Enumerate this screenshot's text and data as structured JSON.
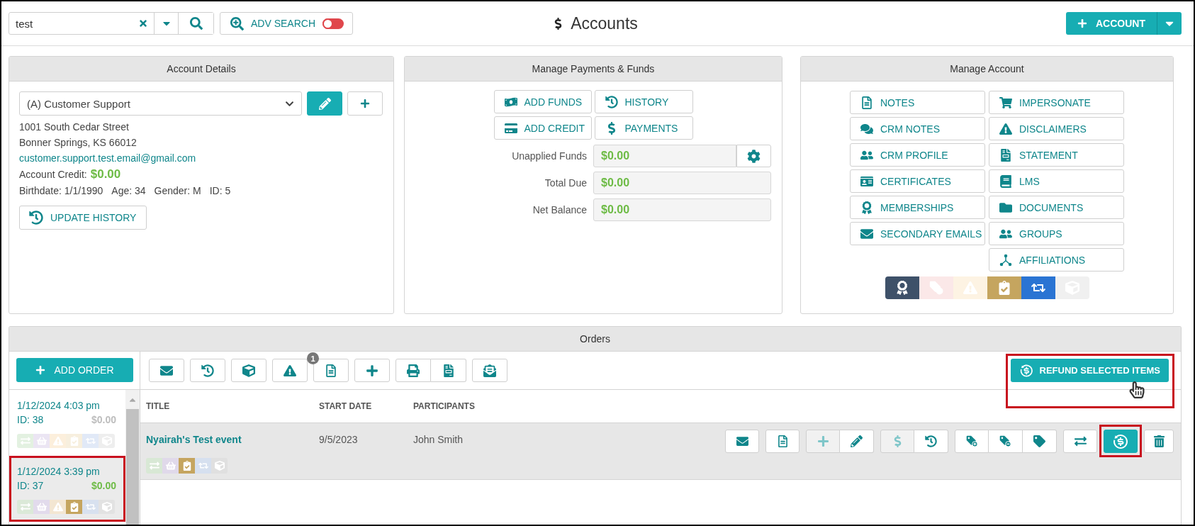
{
  "top_bar": {
    "search": {
      "value": "test"
    },
    "adv_search": {
      "label": "ADV SEARCH",
      "on": false
    },
    "title": "Accounts",
    "new_account": {
      "label": "ACCOUNT"
    }
  },
  "account_details": {
    "title": "Account Details",
    "account": {
      "value": "(A) Customer Support"
    },
    "address": [
      "1001 South Cedar Street",
      "Bonner Springs, KS 66012"
    ],
    "email": "customer.support.test.email@gmail.com",
    "credit": {
      "label": "Account Credit:",
      "value": "$0.00"
    },
    "facts": [
      "Birthdate: 1/1/1990",
      "Age: 34",
      "Gender: M",
      "ID: 5"
    ],
    "update_history": {
      "label": "UPDATE HISTORY"
    }
  },
  "payments": {
    "title": "Manage Payments & Funds",
    "buttons": [
      {
        "kind": "add_funds",
        "label": "ADD FUNDS"
      },
      {
        "kind": "history",
        "label": "HISTORY"
      },
      {
        "kind": "add_credit",
        "label": "ADD CREDIT"
      },
      {
        "kind": "payments",
        "label": "PAYMENTS"
      }
    ],
    "fields": [
      {
        "label": "Unapplied Funds",
        "value": "$0.00",
        "settings": true
      },
      {
        "label": "Total Due",
        "value": "$0.00",
        "settings": false
      },
      {
        "label": "Net Balance",
        "value": "$0.00",
        "settings": false
      }
    ]
  },
  "manage_account": {
    "title": "Manage Account",
    "columns": [
      [
        {
          "kind": "notes",
          "label": "NOTES"
        },
        {
          "kind": "crm_notes",
          "label": "CRM NOTES"
        },
        {
          "kind": "crm_profile",
          "label": "CRM PROFILE"
        },
        {
          "kind": "certificates",
          "label": "CERTIFICATES"
        },
        {
          "kind": "memberships",
          "label": "MEMBERSHIPS"
        },
        {
          "kind": "secondary_emails",
          "label": "SECONDARY EMAILS"
        }
      ],
      [
        {
          "kind": "impersonate",
          "label": "IMPERSONATE"
        },
        {
          "kind": "disclaimers",
          "label": "DISCLAIMERS"
        },
        {
          "kind": "statement",
          "label": "STATEMENT"
        },
        {
          "kind": "lms",
          "label": "LMS"
        },
        {
          "kind": "documents",
          "label": "DOCUMENTS"
        },
        {
          "kind": "groups",
          "label": "GROUPS"
        },
        {
          "kind": "affiliations",
          "label": "AFFILIATIONS"
        }
      ]
    ],
    "status_icons": [
      {
        "kind": "ribbon",
        "color": "#3e5169"
      },
      {
        "kind": "tag_remove",
        "color": "#fbe8e8"
      },
      {
        "kind": "warning",
        "color": "#fdf3e3"
      },
      {
        "kind": "clipboard",
        "color": "#c5a55f"
      },
      {
        "kind": "repeat",
        "color": "#2a74d3"
      },
      {
        "kind": "box",
        "color": "#f0f0f0"
      }
    ]
  },
  "orders": {
    "title": "Orders",
    "add_order": {
      "label": "ADD ORDER"
    },
    "list": [
      {
        "date": "1/12/2024 4:03 pm",
        "id": "ID: 38",
        "amount": "$0.00",
        "amount_muted": true,
        "selected": false,
        "highlighted": false,
        "status_icons": [
          {
            "kind": "transfer",
            "color": "#e3f1e1"
          },
          {
            "kind": "basket",
            "color": "#ebe5f3"
          },
          {
            "kind": "warning",
            "color": "#fcefdc"
          },
          {
            "kind": "clipboard",
            "color": "#f7efde"
          },
          {
            "kind": "repeat",
            "color": "#e1e9f7"
          },
          {
            "kind": "box",
            "color": "#eeeeee"
          }
        ]
      },
      {
        "date": "1/12/2024 3:39 pm",
        "id": "ID: 37",
        "amount": "$0.00",
        "amount_muted": false,
        "selected": true,
        "highlighted": true,
        "status_icons": [
          {
            "kind": "transfer",
            "color": "#dbe9d8"
          },
          {
            "kind": "basket",
            "color": "#e2dbec"
          },
          {
            "kind": "warning",
            "color": "#f3e6d2"
          },
          {
            "kind": "clipboard",
            "color": "#c5a55f"
          },
          {
            "kind": "repeat",
            "color": "#d8e1ef"
          },
          {
            "kind": "box",
            "color": "#e2e2e2"
          }
        ]
      }
    ],
    "toolbar": [
      [
        {
          "kind": "email"
        }
      ],
      [
        {
          "kind": "history"
        }
      ],
      [
        {
          "kind": "box"
        }
      ],
      [
        {
          "kind": "warning"
        }
      ],
      [
        {
          "kind": "notes",
          "badge": "1"
        }
      ],
      [
        {
          "kind": "add"
        }
      ],
      [
        {
          "kind": "print"
        },
        {
          "kind": "statement"
        }
      ],
      [
        {
          "kind": "send"
        }
      ]
    ],
    "refund_selected": {
      "label": "REFUND SELECTED ITEMS",
      "highlighted": true,
      "pointer": true
    },
    "table": {
      "columns": [
        "TITLE",
        "START DATE",
        "PARTICIPANTS"
      ],
      "rows": [
        {
          "title": "Nyairah's Test event",
          "start_date": "9/5/2023",
          "participants": "John Smith",
          "status_icons": [
            {
              "kind": "transfer",
              "color": "#d8e8d5"
            },
            {
              "kind": "basket",
              "color": "#e0d9ea"
            },
            {
              "kind": "clipboard",
              "color": "#c5a55f"
            },
            {
              "kind": "repeat",
              "color": "#d6e0ef"
            },
            {
              "kind": "box",
              "color": "#e0e0e0"
            }
          ],
          "actions": [
            [
              {
                "kind": "email",
                "disabled": false,
                "highlighted": false
              }
            ],
            [
              {
                "kind": "notes",
                "disabled": false,
                "highlighted": false
              }
            ],
            [
              {
                "kind": "add",
                "disabled": true,
                "highlighted": false
              },
              {
                "kind": "edit",
                "disabled": false,
                "highlighted": false
              }
            ],
            [
              {
                "kind": "payment",
                "disabled": true,
                "highlighted": false
              },
              {
                "kind": "history",
                "disabled": false,
                "highlighted": false
              }
            ],
            [
              {
                "kind": "tag_add",
                "disabled": false,
                "highlighted": false
              },
              {
                "kind": "tag_remove",
                "disabled": false,
                "highlighted": false
              },
              {
                "kind": "tag",
                "disabled": false,
                "highlighted": false
              }
            ],
            [
              {
                "kind": "transfer",
                "disabled": false,
                "highlighted": false
              }
            ],
            [
              {
                "kind": "refund",
                "disabled": false,
                "highlighted": true
              }
            ],
            [
              {
                "kind": "delete",
                "disabled": false,
                "highlighted": false
              }
            ]
          ]
        }
      ]
    }
  }
}
